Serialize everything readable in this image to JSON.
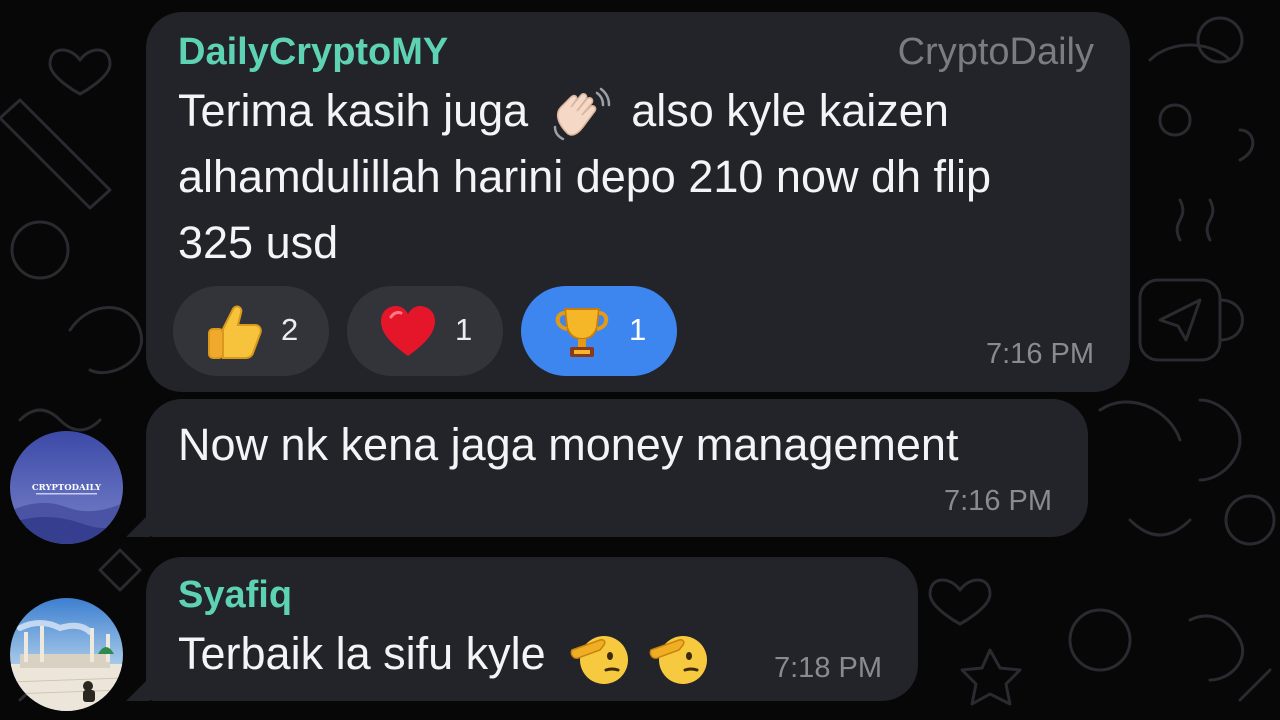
{
  "messages": [
    {
      "sender": "DailyCryptoMY",
      "channel": "CryptoDaily",
      "lines": [
        "Terima kasih juga",
        "also kyle kaizen",
        "alhamdulillah harini depo 210 now dh flip",
        "325 usd"
      ],
      "emoji": "waving-hand-emoji",
      "reactions": [
        {
          "icon": "thumbs-up-emoji",
          "count": "2",
          "active": false
        },
        {
          "icon": "red-heart-emoji",
          "count": "1",
          "active": false
        },
        {
          "icon": "trophy-emoji",
          "count": "1",
          "active": true
        }
      ],
      "time": "7:16 PM"
    },
    {
      "text": "Now nk kena jaga money management",
      "time": "7:16 PM",
      "avatar_label": "CRYPTODAILY"
    },
    {
      "sender": "Syafiq",
      "text": "Terbaik la sifu kyle",
      "emojis": [
        "saluting-face-emoji",
        "saluting-face-emoji"
      ],
      "time": "7:18 PM"
    }
  ],
  "colors": {
    "background": "#070707",
    "bubble": "#23232a",
    "sender_name": "#5dd3b4",
    "reaction_active": "#3d86f0",
    "reaction_inactive": "#33333a"
  }
}
